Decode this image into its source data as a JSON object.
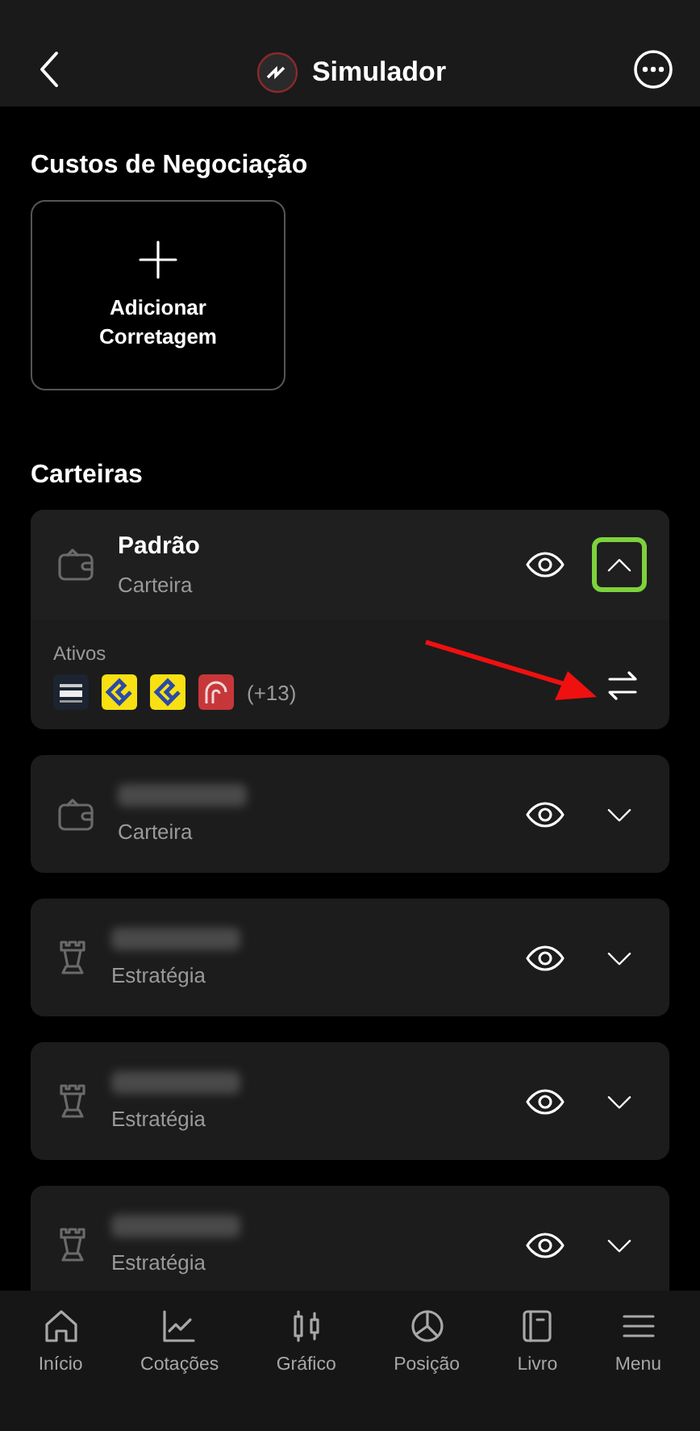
{
  "header": {
    "title": "Simulador"
  },
  "costs": {
    "title": "Custos de Negociação",
    "add_label": "Adicionar Corretagem"
  },
  "portfolios": {
    "title": "Carteiras",
    "items": [
      {
        "kind": "wallet",
        "name": "Padrão",
        "subtitle": "Carteira",
        "expanded": true,
        "highlighted": true,
        "assets_label": "Ativos",
        "assets": [
          {
            "kind": "dark"
          },
          {
            "kind": "yellow"
          },
          {
            "kind": "yellow"
          },
          {
            "kind": "red"
          }
        ],
        "more": "(+13)"
      },
      {
        "kind": "wallet",
        "subtitle": "Carteira",
        "expanded": false,
        "highlighted": false
      },
      {
        "kind": "strategy",
        "subtitle": "Estratégia",
        "expanded": false,
        "highlighted": false
      },
      {
        "kind": "strategy",
        "subtitle": "Estratégia",
        "expanded": false,
        "highlighted": false
      },
      {
        "kind": "strategy",
        "subtitle": "Estratégia",
        "expanded": false,
        "highlighted": false
      }
    ]
  },
  "annotations": [
    {
      "kind": "arrow"
    }
  ],
  "nav": [
    {
      "label": "Início"
    },
    {
      "label": "Cotações"
    },
    {
      "label": "Gráfico"
    },
    {
      "label": "Posição"
    },
    {
      "label": "Livro"
    },
    {
      "label": "Menu"
    }
  ]
}
